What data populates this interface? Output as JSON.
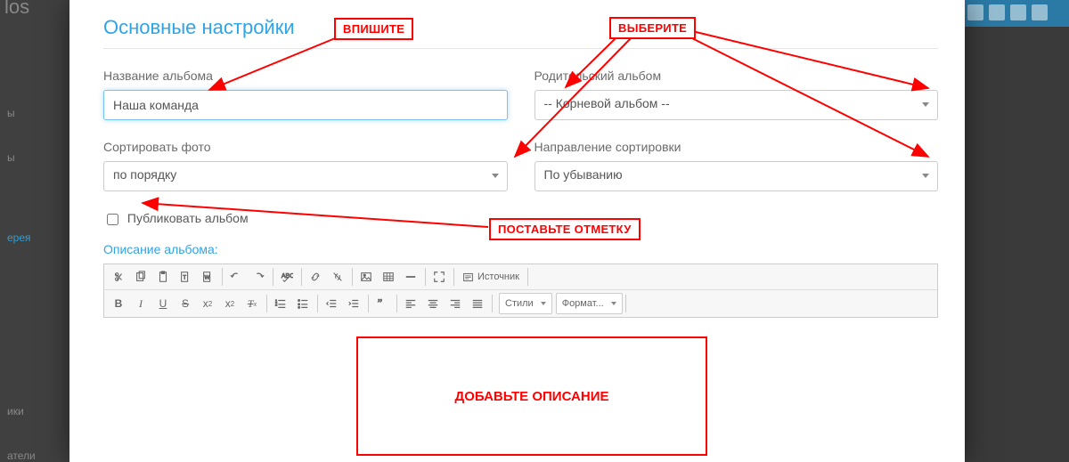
{
  "bg": {
    "logo": "los",
    "menu": [
      "",
      "ы",
      "ы",
      "",
      "ерея",
      "",
      "ики",
      "атели"
    ]
  },
  "modal": {
    "title": "Основные настройки",
    "album_name_label": "Название альбома",
    "album_name_value": "Наша команда",
    "parent_label": "Родительский альбом",
    "parent_value": "-- Корневой альбом --",
    "sort_label": "Сортировать фото",
    "sort_value": "по порядку",
    "dir_label": "Направление сортировки",
    "dir_value": "По убыванию",
    "publish_label": "Публиковать альбом",
    "desc_label": "Описание альбома:",
    "toolbar": {
      "source": "Источник",
      "styles": "Стили",
      "format": "Формат..."
    }
  },
  "annotations": {
    "a1": "ВПИШИТЕ",
    "a2": "ВЫБЕРИТЕ",
    "a3": "ПОСТАВЬТЕ ОТМЕТКУ",
    "a4": "ДОБАВЬТЕ ОПИСАНИЕ"
  }
}
